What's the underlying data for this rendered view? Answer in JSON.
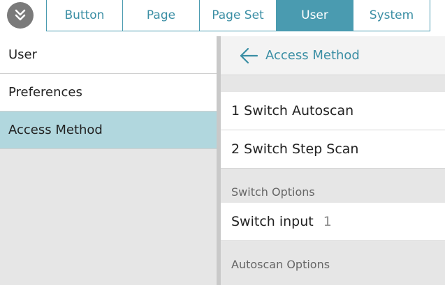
{
  "tabs": [
    {
      "label": "Button"
    },
    {
      "label": "Page"
    },
    {
      "label": "Page Set"
    },
    {
      "label": "User"
    },
    {
      "label": "System"
    }
  ],
  "active_tab": "User",
  "sidebar": {
    "items": [
      {
        "label": "User"
      },
      {
        "label": "Preferences"
      },
      {
        "label": "Access Method"
      }
    ],
    "selected": "Access Method"
  },
  "panel": {
    "title": "Access Method",
    "options": [
      {
        "label": "1 Switch Autoscan"
      },
      {
        "label": "2 Switch Step Scan"
      }
    ],
    "switch_options": {
      "label": "Switch Options",
      "switch_input": {
        "label": "Switch input",
        "value": "1"
      }
    },
    "autoscan_options": {
      "label": "Autoscan Options"
    }
  },
  "colors": {
    "accent": "#4a9bb0",
    "selected_bg": "#b1d7de"
  },
  "icons": {
    "menu": "double-chevron-down-icon",
    "back": "arrow-left-icon"
  }
}
